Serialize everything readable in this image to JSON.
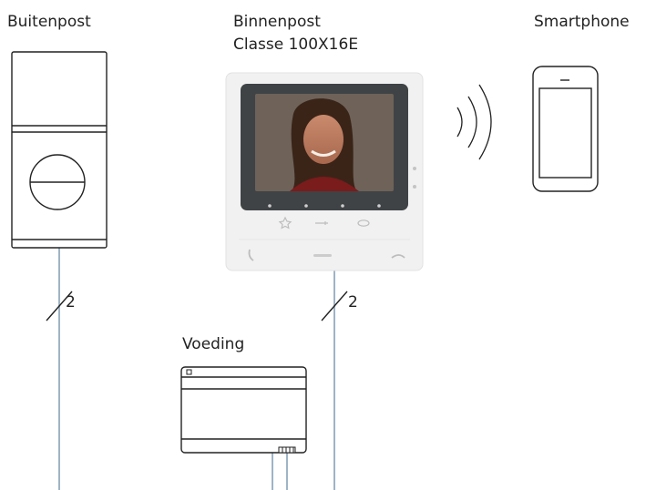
{
  "labels": {
    "outdoor": "Buitenpost",
    "indoor_line1": "Binnenpost",
    "indoor_line2": "Classe 100X16E",
    "smartphone": "Smartphone",
    "power": "Voeding",
    "wire_count_left": "2",
    "wire_count_right": "2"
  },
  "colors": {
    "wire": "#9fb4c6",
    "outline": "#222222",
    "device_body": "#f1f1f1"
  }
}
